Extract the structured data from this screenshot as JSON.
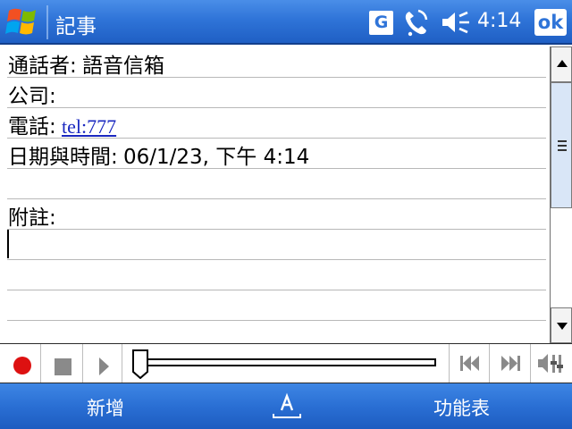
{
  "titlebar": {
    "app_title": "記事",
    "status_icons": [
      "windows-logo-icon",
      "g-icon",
      "phone-signal-icon",
      "speaker-mute-icon"
    ],
    "g_label": "G",
    "time": "4:14",
    "ok_label": "ok"
  },
  "note": {
    "caller_label": "通話者:",
    "caller_value": "語音信箱",
    "company_label": "公司:",
    "phone_label": "電話:",
    "phone_value": "tel:777",
    "datetime_label": "日期與時間:",
    "datetime_value": "06/1/23, 下午 4:14",
    "memo_label": "附註:"
  },
  "recorder": {
    "buttons": [
      "record-icon",
      "stop-icon",
      "play-icon",
      "previous-track-icon",
      "next-track-icon",
      "volume-icon"
    ],
    "position": 0
  },
  "softkeys": {
    "left": "新增",
    "center_icon": "input-panel-icon",
    "right": "功能表"
  },
  "colors": {
    "titlebar": "#2f74d8",
    "softbar": "#2a6fd4",
    "link": "#1a28c0",
    "record": "#dd1111"
  }
}
